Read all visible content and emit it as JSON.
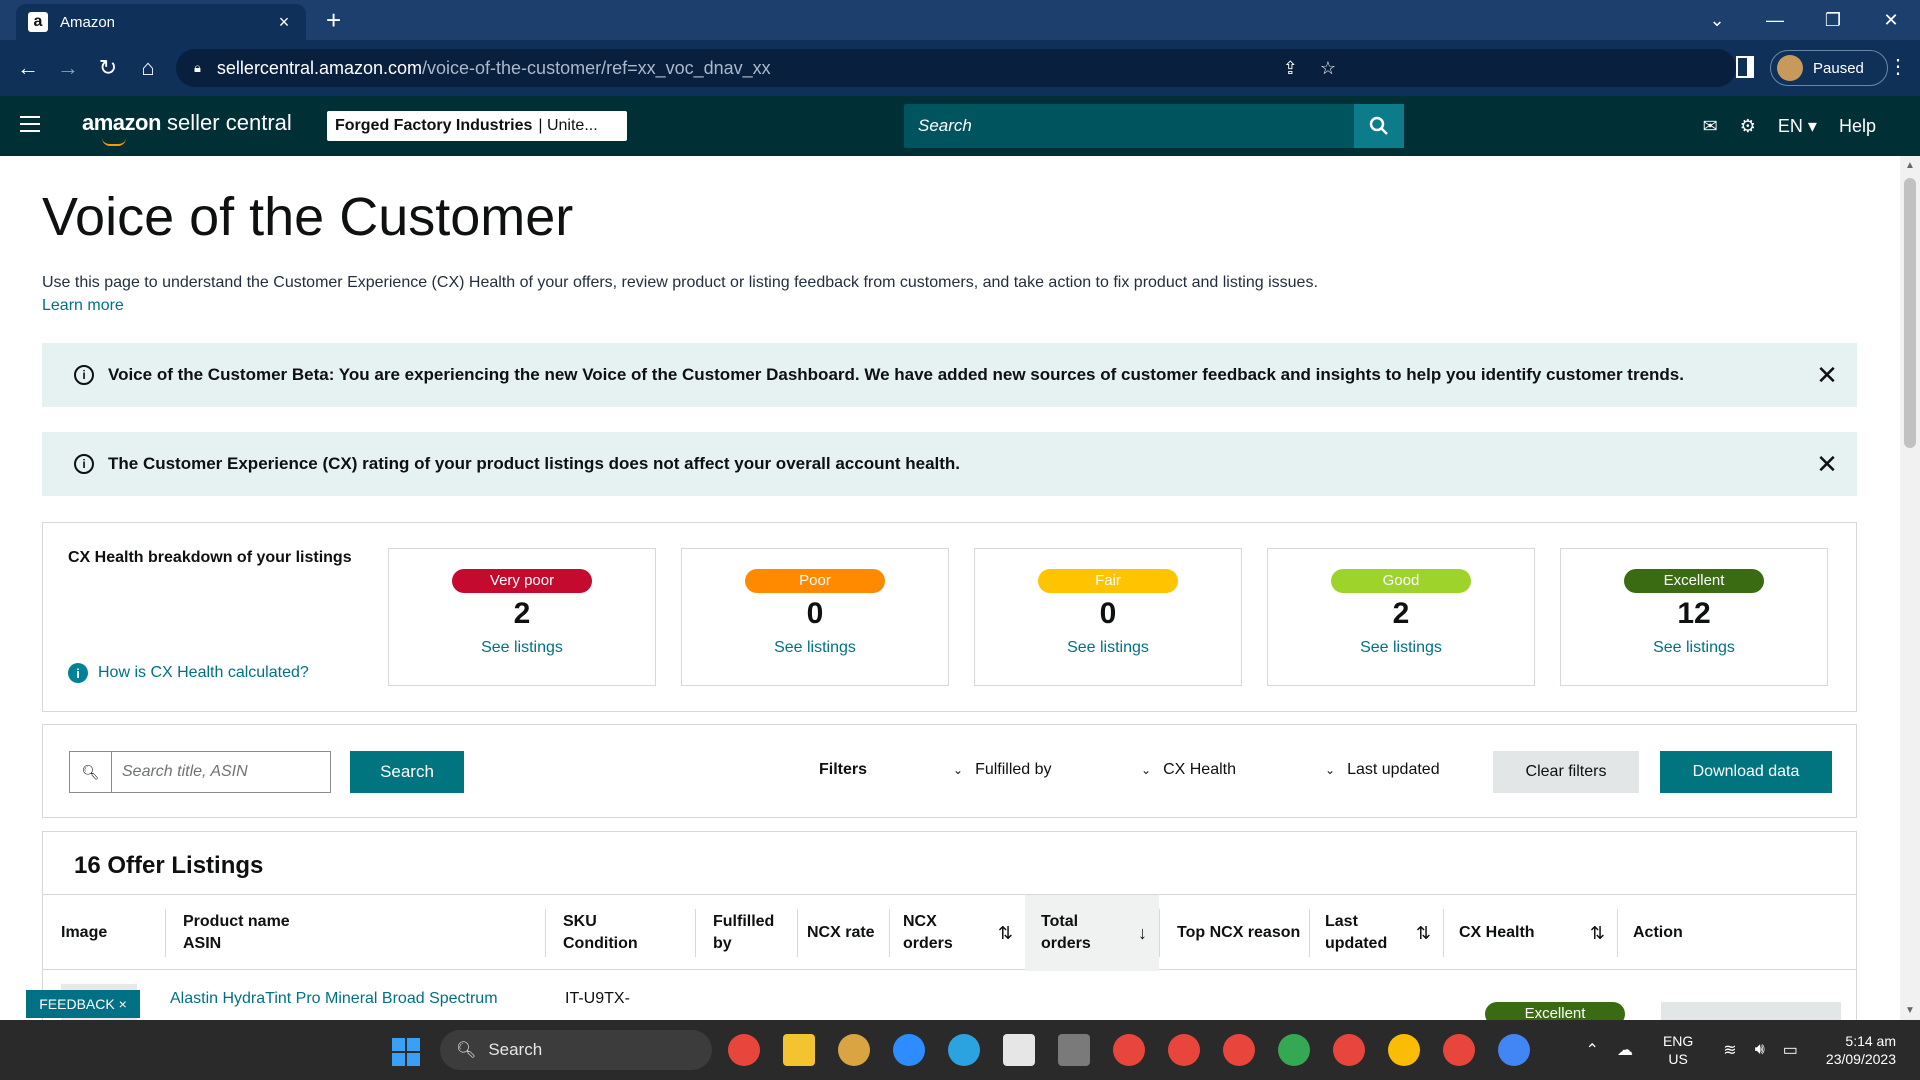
{
  "browser": {
    "tab_title": "Amazon",
    "url_host": "sellercentral.amazon.com",
    "url_path": "/voice-of-the-customer/ref=xx_voc_dnav_xx",
    "profile_label": "Paused"
  },
  "header": {
    "logo_prefix": "amazon",
    "logo_suffix": "seller central",
    "account_name": "Forged Factory Industries",
    "account_region": "| Unite...",
    "search_placeholder": "Search",
    "language": "EN",
    "help_label": "Help"
  },
  "page": {
    "title": "Voice of the Customer",
    "intro": "Use this page to understand the Customer Experience (CX) Health of your offers, review product or listing feedback from customers, and take action to fix product and listing issues.",
    "learn_more": "Learn more"
  },
  "banners": [
    {
      "text": "Voice of the Customer Beta: You are experiencing the new Voice of the Customer Dashboard. We have added new sources of customer feedback and insights to help you identify customer trends."
    },
    {
      "text": "The Customer Experience (CX) rating of your product listings does not affect your overall account health."
    }
  ],
  "cx_health": {
    "title": "CX Health breakdown of your listings",
    "how_link": "How is CX Health calculated?",
    "see_label": "See listings",
    "buckets": [
      {
        "label": "Very poor",
        "count": "2",
        "color": "#c40a2e"
      },
      {
        "label": "Poor",
        "count": "0",
        "color": "#ff8a00"
      },
      {
        "label": "Fair",
        "count": "0",
        "color": "#ffc400"
      },
      {
        "label": "Good",
        "count": "2",
        "color": "#9ed32b"
      },
      {
        "label": "Excellent",
        "count": "12",
        "color": "#3a6b13"
      }
    ]
  },
  "filters": {
    "search_placeholder": "Search title, ASIN",
    "search_button": "Search",
    "label": "Filters",
    "fulfilled_by": "Fulfilled by",
    "cx_health": "CX Health",
    "last_updated": "Last updated",
    "clear": "Clear filters",
    "download": "Download data"
  },
  "listings": {
    "title": "16 Offer Listings",
    "columns": {
      "image": "Image",
      "product_1": "Product name",
      "product_2": "ASIN",
      "sku_1": "SKU",
      "sku_2": "Condition",
      "fulfilled": "Fulfilled by",
      "ncx_rate": "NCX rate",
      "ncx_orders_1": "NCX",
      "ncx_orders_2": "orders",
      "total_1": "Total",
      "total_2": "orders",
      "top_reason": "Top NCX reason",
      "updated_1": "Last",
      "updated_2": "updated",
      "cx_health": "CX Health",
      "action": "Action"
    },
    "first_row": {
      "product": "Alastin HydraTint Pro Mineral Broad Spectrum",
      "sku": "IT-U9TX-",
      "cx_health": "Excellent"
    }
  },
  "feedback_label": "FEEDBACK ×",
  "taskbar": {
    "search": "Search",
    "lang_1": "ENG",
    "lang_2": "US",
    "time": "5:14 am",
    "date": "23/09/2023"
  }
}
